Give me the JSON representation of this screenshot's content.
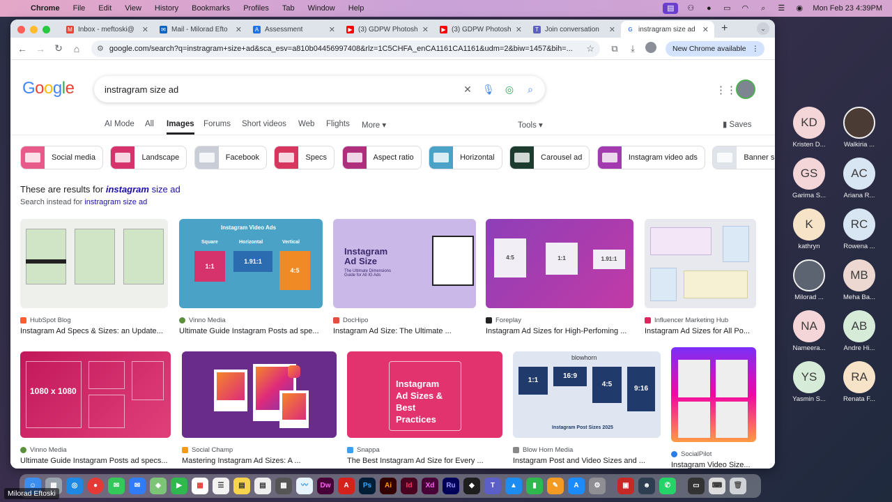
{
  "menubar": {
    "app": "Chrome",
    "items": [
      "File",
      "Edit",
      "View",
      "History",
      "Bookmarks",
      "Profiles",
      "Tab",
      "Window",
      "Help"
    ],
    "clock": "Mon Feb 23  4:39PM"
  },
  "tabs": [
    {
      "label": "Inbox - meftoski@",
      "color": "#ea4335"
    },
    {
      "label": "Mail - Milorad Efto",
      "color": "#0a66c2"
    },
    {
      "label": "Assessment",
      "color": "#1a73e8"
    },
    {
      "label": "(3) GDPW Photosh",
      "color": "#ff0000"
    },
    {
      "label": "(3) GDPW Photosh",
      "color": "#ff0000"
    },
    {
      "label": "Join conversation",
      "color": "#5b5fc7"
    },
    {
      "label": "instragram size ad",
      "color": "#4285f4"
    }
  ],
  "address": {
    "url": "google.com/search?q=instragram+size+ad&sca_esv=a810b04456997408&rlz=1C5CHFA_enCA1161CA1161&udm=2&biw=1457&bih=...",
    "new_chrome": "New Chrome available"
  },
  "search": {
    "query": "instragram size ad"
  },
  "filters": {
    "items": [
      "AI Mode",
      "All",
      "Images",
      "Forums",
      "Short videos",
      "Web",
      "Flights",
      "More"
    ],
    "active": "Images",
    "tools": "Tools",
    "saves": "Saves"
  },
  "chips": [
    {
      "label": "Social media",
      "color": "#e85a8a"
    },
    {
      "label": "Landscape",
      "color": "#d6336c"
    },
    {
      "label": "Facebook",
      "color": "#c9ced6"
    },
    {
      "label": "Specs",
      "color": "#d7365e"
    },
    {
      "label": "Aspect ratio",
      "color": "#b02f7c"
    },
    {
      "label": "Horizontal",
      "color": "#4aa3c7"
    },
    {
      "label": "Carousel ad",
      "color": "#1d3b2f"
    },
    {
      "label": "Instagram video ads",
      "color": "#a33ab0"
    },
    {
      "label": "Banner s",
      "color": "#dfe3ea"
    }
  ],
  "notice": {
    "prefix": "These are results for ",
    "corrected": "instagram",
    "suffix": " size ad",
    "instead_prefix": "Search instead for ",
    "instead_link": "instragram size ad"
  },
  "results_row1": [
    {
      "source": "HubSpot Blog",
      "title": "Instagram Ad Specs & Sizes: an Update...",
      "fav": "#ff5c35"
    },
    {
      "source": "Vinno Media",
      "title": "Ultimate Guide Instagram Posts ad spe...",
      "fav": "#5a8f3c"
    },
    {
      "source": "DocHipo",
      "title": "Instagram Ad Size: The Ultimate ...",
      "fav": "#e74c3c"
    },
    {
      "source": "Foreplay",
      "title": "Instagram Ad Sizes for High-Perfoming ...",
      "fav": "#222222"
    },
    {
      "source": "Influencer Marketing Hub",
      "title": "Instagram Ad Sizes for All Po...",
      "fav": "#e0245e"
    }
  ],
  "results_row2": [
    {
      "source": "Vinno Media",
      "title": "Ultimate Guide Instagram Posts ad specs...",
      "fav": "#5a8f3c"
    },
    {
      "source": "Social Champ",
      "title": "Mastering Instagram Ad Sizes: A ...",
      "fav": "#f39c12"
    },
    {
      "source": "Snappa",
      "title": "The Best Instagram Ad Size for Every ...",
      "fav": "#3aa0f3"
    },
    {
      "source": "Blow Horn Media",
      "title": "Instagram Post and Video Sizes and ...",
      "fav": "#888888"
    },
    {
      "source": "SocialPilot",
      "title": "Instagram Video Size...",
      "fav": "#2b7de9"
    }
  ],
  "image_text": {
    "ivads": "Instagram Video Ads",
    "square": "Square",
    "horizontal": "Horizontal",
    "vertical": "Vertical",
    "r11": "1:1",
    "r191": "1.91:1",
    "r45": "4:5",
    "dochipo_title": "Instagram Ad Size",
    "dochipo_sub": "The Ultimate Dimensions Guide for All IG Ads",
    "vinno2": "1080 x 1080",
    "snappa": "Instagram Ad Sizes & Best Practices",
    "blowhorn": "blowhorn",
    "r169": "16:9",
    "r916": "9:16",
    "blowhorn_footer": "Instagram Post Sizes 2025"
  },
  "participants": [
    {
      "initials": "KD",
      "name": "Kristen D...",
      "bg": "#f4d6d8"
    },
    {
      "initials": "",
      "name": "Walkiria ...",
      "bg": "#4a3b35"
    },
    {
      "initials": "GS",
      "name": "Garima S...",
      "bg": "#f4d6d8"
    },
    {
      "initials": "AC",
      "name": "Ariana R...",
      "bg": "#d8e6f4"
    },
    {
      "initials": "K",
      "name": "kathryn",
      "bg": "#f6e3c8"
    },
    {
      "initials": "RC",
      "name": "Rowena ...",
      "bg": "#d8e6f4"
    },
    {
      "initials": "",
      "name": "Milorad ...",
      "bg": "#5b6470"
    },
    {
      "initials": "MB",
      "name": "Meha Ba...",
      "bg": "#ecd8d0"
    },
    {
      "initials": "NA",
      "name": "Nameera...",
      "bg": "#f4d6d8"
    },
    {
      "initials": "AB",
      "name": "Andre Hi...",
      "bg": "#d6ecd9"
    },
    {
      "initials": "YS",
      "name": "Yasmin S...",
      "bg": "#d6ecd9"
    },
    {
      "initials": "RA",
      "name": "Renata F...",
      "bg": "#f6e3c8"
    }
  ],
  "presenter": "Milorad Eftoski",
  "dock_labels": [
    "Dw",
    "Ps",
    "Ai",
    "Id",
    "Xd",
    "Ru"
  ]
}
